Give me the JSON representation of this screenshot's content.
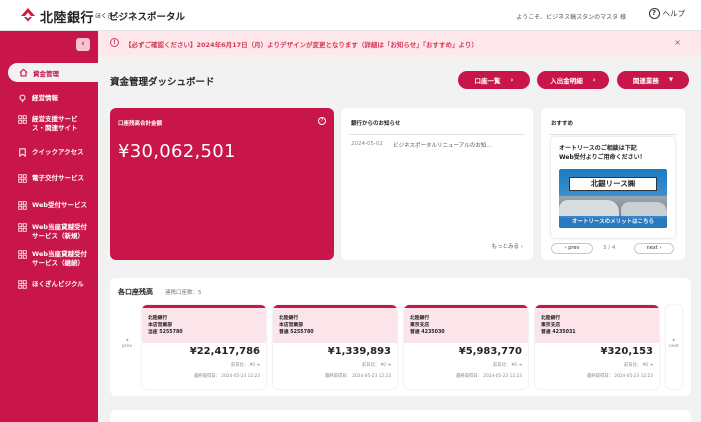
{
  "header": {
    "logo_main": "北陸銀行",
    "logo_sub": "ほくぎん",
    "logo_sub2": "ビジネスポータル",
    "welcome": "ようこそ、ビジネス稿スタンのマスタ 様",
    "help_label": "ヘルプ"
  },
  "sidebar": {
    "collapse_icon": "chevron-left-icon",
    "items": [
      {
        "label": "資金管理",
        "icon": "home-icon",
        "active": true
      },
      {
        "label": "経営情報",
        "icon": "lightbulb-icon"
      },
      {
        "label": "経営支援サービス・関連サイト",
        "line1": "経営支援サービ",
        "line2": "ス・関連サイト",
        "icon": "grid-icon"
      },
      {
        "label": "クイックアクセス",
        "icon": "bookmark-icon"
      },
      {
        "label": "電子交付サービス",
        "icon": "grid-icon"
      },
      {
        "label": "Web受付サービス",
        "icon": "grid-icon"
      },
      {
        "label": "Web当座貸越受付サービス（新規）",
        "line1": "Web当座貸越受付",
        "line2": "サービス（新規）",
        "icon": "grid-icon"
      },
      {
        "label": "Web当座貸越受付サービス（継続）",
        "line1": "Web当座貸越受付",
        "line2": "サービス（継続）",
        "icon": "grid-icon"
      },
      {
        "label": "ほくぎんビジクル",
        "icon": "grid-icon"
      }
    ]
  },
  "notice": {
    "text": "【必ずご確認ください】2024年6月17日（月）よりデザインが変更となります（詳細は「お知らせ」「おすすめ」より）",
    "close": "×"
  },
  "page": {
    "title": "資金管理ダッシュボード",
    "buttons": [
      {
        "label": "口座一覧",
        "arrow": "›"
      },
      {
        "label": "入出金明細",
        "arrow": "›"
      },
      {
        "label": "関連業務",
        "arrow": "▼"
      }
    ]
  },
  "balance": {
    "label": "口座残高合計金額",
    "amount": "¥30,062,501"
  },
  "news": {
    "title": "銀行からのお知らせ",
    "items": [
      {
        "date": "2024-05-02",
        "text": "ビジネスポータルリニューアルのお知…"
      }
    ],
    "more": "もっとみる ›"
  },
  "recommend": {
    "title": "おすすめ",
    "text_line1": "オートリースのご相談は下記",
    "text_line2": "Web受付よりご用命ください！",
    "banner": "北銀リース㈱",
    "strip": "オートリースのメリットはこちら",
    "prev": "‹  prev",
    "next": "next  ›",
    "page_count": "3 / 4"
  },
  "accounts": {
    "title": "各口座残高",
    "count": "連携口座数：5",
    "prev": "prev",
    "next": "next",
    "cards": [
      {
        "bank": "北陸銀行",
        "branch": "本店営業部",
        "number": "当座 5255780",
        "amount": "¥22,417,786",
        "prev_day": "前日比： ¥0 ➜",
        "fetched": "最終取得日： 2024-05-23 12:23"
      },
      {
        "bank": "北陸銀行",
        "branch": "本店営業部",
        "number": "普通 5255780",
        "amount": "¥1,339,893",
        "prev_day": "前日比： ¥0 ➜",
        "fetched": "最終取得日： 2024-05-23 12:23"
      },
      {
        "bank": "北陸銀行",
        "branch": "東京支店",
        "number": "普通 4235030",
        "amount": "¥5,983,770",
        "prev_day": "前日比： ¥0 ➜",
        "fetched": "最終取得日： 2024-05-23 12:23"
      },
      {
        "bank": "北陸銀行",
        "branch": "東京支店",
        "number": "普通 4235031",
        "amount": "¥320,153",
        "prev_day": "前日比： ¥0 ➜",
        "fetched": "最終取得日： 2024-05-23 12:23"
      }
    ]
  },
  "colors": {
    "brand": "#c8164a",
    "notice_bg": "#fde7ea",
    "notice_text": "#d43a5a",
    "account_head_bg": "#fbe4ea"
  }
}
